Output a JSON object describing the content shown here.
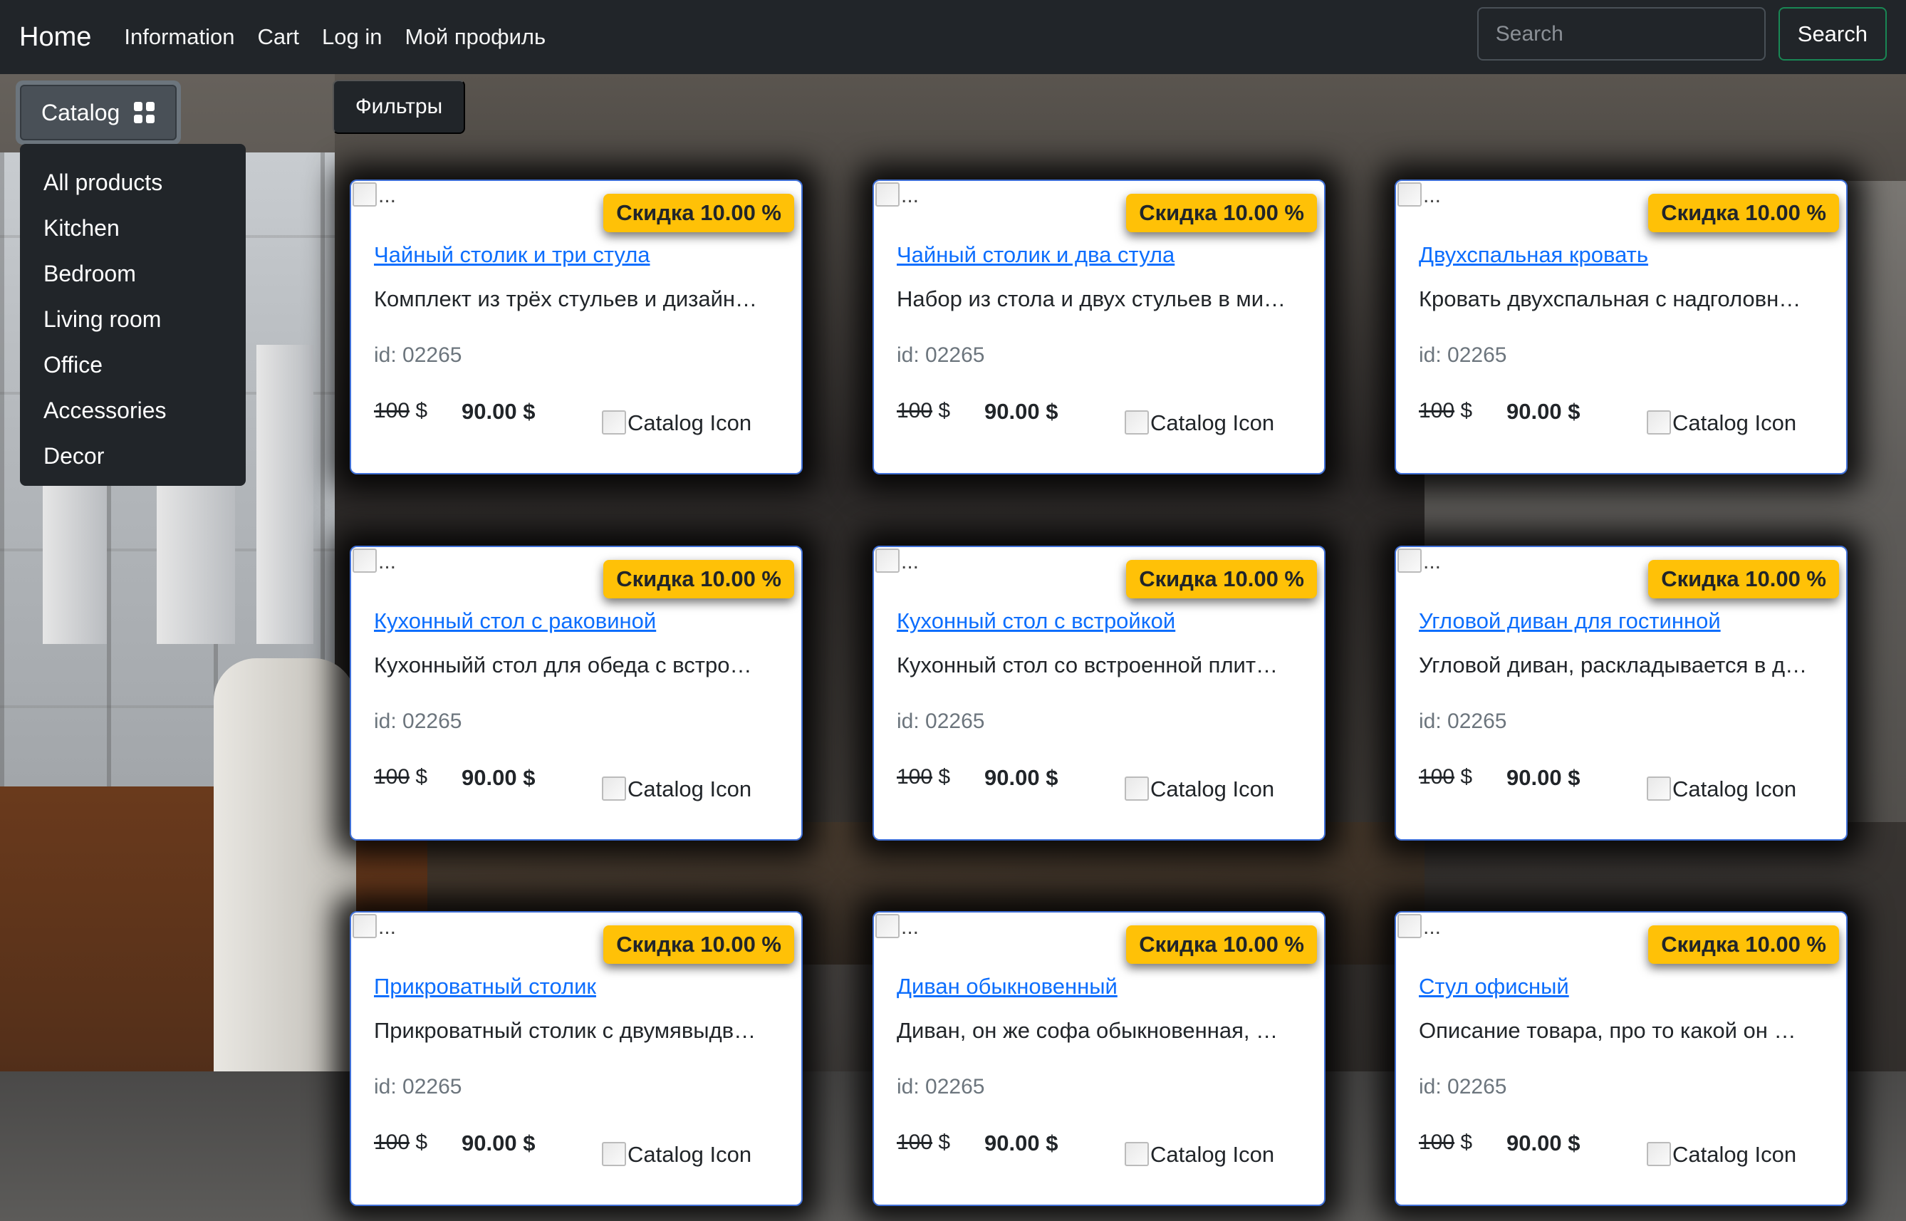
{
  "nav": {
    "brand": "Home",
    "links": [
      "Information",
      "Cart",
      "Log in",
      "Мой профиль"
    ],
    "search_placeholder": "Search",
    "search_button": "Search"
  },
  "catalog": {
    "button_label": "Catalog",
    "items": [
      "All products",
      "Kitchen",
      "Bedroom",
      "Living room",
      "Office",
      "Accessories",
      "Decor"
    ]
  },
  "filters_label": "Фильтры",
  "products": [
    {
      "title": "Чайный столик и три стула",
      "description": "Комплект из трёх стульев и дизайн…",
      "id": "id: 02265",
      "old_price": "100",
      "currency": " $",
      "new_price": "90.00 $",
      "discount": "Скидка 10.00 %",
      "image_alt": "...",
      "icon_alt": "Catalog Icon"
    },
    {
      "title": "Чайный столик и два стула",
      "description": "Набор из стола и двух стульев в ми…",
      "id": "id: 02265",
      "old_price": "100",
      "currency": " $",
      "new_price": "90.00 $",
      "discount": "Скидка 10.00 %",
      "image_alt": "...",
      "icon_alt": "Catalog Icon"
    },
    {
      "title": "Двухспальная кровать",
      "description": "Кровать двухспальная с надголовн…",
      "id": "id: 02265",
      "old_price": "100",
      "currency": " $",
      "new_price": "90.00 $",
      "discount": "Скидка 10.00 %",
      "image_alt": "...",
      "icon_alt": "Catalog Icon"
    },
    {
      "title": "Кухонный стол с раковиной",
      "description": "Кухонныйй стол для обеда с встро…",
      "id": "id: 02265",
      "old_price": "100",
      "currency": " $",
      "new_price": "90.00 $",
      "discount": "Скидка 10.00 %",
      "image_alt": "...",
      "icon_alt": "Catalog Icon"
    },
    {
      "title": "Кухонный стол с встройкой",
      "description": "Кухонный стол со встроенной плит…",
      "id": "id: 02265",
      "old_price": "100",
      "currency": " $",
      "new_price": "90.00 $",
      "discount": "Скидка 10.00 %",
      "image_alt": "...",
      "icon_alt": "Catalog Icon"
    },
    {
      "title": "Угловой диван для гостинной",
      "description": "Угловой диван, раскладывается в д…",
      "id": "id: 02265",
      "old_price": "100",
      "currency": " $",
      "new_price": "90.00 $",
      "discount": "Скидка 10.00 %",
      "image_alt": "...",
      "icon_alt": "Catalog Icon"
    },
    {
      "title": "Прикроватный столик",
      "description": "Прикроватный столик с двумявыдв…",
      "id": "id: 02265",
      "old_price": "100",
      "currency": " $",
      "new_price": "90.00 $",
      "discount": "Скидка 10.00 %",
      "image_alt": "...",
      "icon_alt": "Catalog Icon"
    },
    {
      "title": "Диван обыкновенный",
      "description": "Диван, он же софа обыкновенная, …",
      "id": "id: 02265",
      "old_price": "100",
      "currency": " $",
      "new_price": "90.00 $",
      "discount": "Скидка 10.00 %",
      "image_alt": "...",
      "icon_alt": "Catalog Icon"
    },
    {
      "title": "Стул офисный",
      "description": "Описание товара, про то какой он …",
      "id": "id: 02265",
      "old_price": "100",
      "currency": " $",
      "new_price": "90.00 $",
      "discount": "Скидка 10.00 %",
      "image_alt": "...",
      "icon_alt": "Catalog Icon"
    }
  ],
  "colors": {
    "navbar": "#212529",
    "badge": "#ffc107",
    "link": "#0d6efd",
    "search_border": "#198754"
  }
}
